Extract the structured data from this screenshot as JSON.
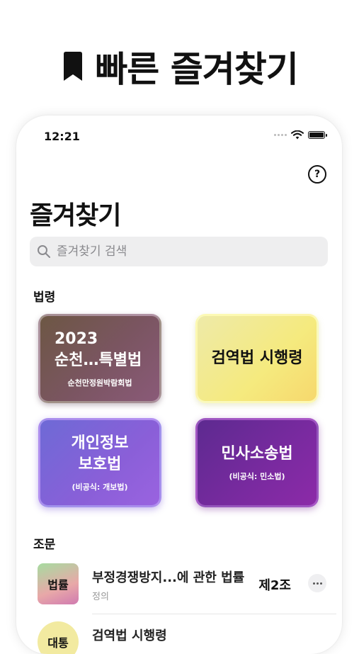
{
  "promo": {
    "title": "빠른 즐겨찾기",
    "icon": "bookmark-icon"
  },
  "status_bar": {
    "time": "12:21"
  },
  "screen": {
    "title": "즐겨찾기",
    "help_label": "?"
  },
  "search": {
    "placeholder": "즐겨찾기 검색"
  },
  "laws_section": {
    "label": "법령",
    "cards": [
      {
        "lines": [
          "2023",
          "순천…특별법"
        ],
        "subtitle": "순천만정원박람회법"
      },
      {
        "lines": [
          "검역법 시행령"
        ],
        "subtitle": ""
      },
      {
        "lines": [
          "개인정보",
          "보호법"
        ],
        "subtitle": "(비공식: 개보법)"
      },
      {
        "lines": [
          "민사소송법"
        ],
        "subtitle": "(비공식: 민소법)"
      }
    ]
  },
  "articles_section": {
    "label": "조문",
    "items": [
      {
        "thumb": "법률",
        "title": "부정경쟁방지...에 관한 법률",
        "subtitle": "정의",
        "article": "제2조"
      },
      {
        "thumb": "대통",
        "title": "검역법 시행령",
        "subtitle": "",
        "article": ""
      }
    ]
  },
  "colors": {
    "background": "#ffffff",
    "search_bg": "#eeeeef",
    "text": "#111111"
  }
}
